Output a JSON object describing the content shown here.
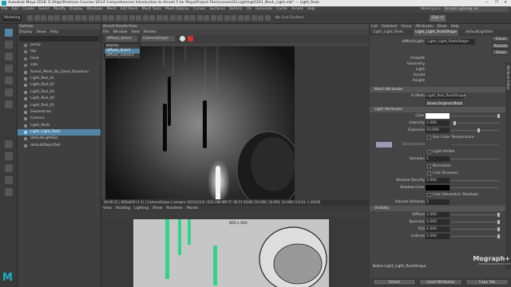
{
  "titlebar": {
    "title": "Autodesk Maya 2018: E:\\Allgs\\Premium Courses \\D\\14 Comprehensive Introduction to Arnold 5 for Maya\\Project Files\\scenes\\03 Lighting\\0303_Mesh_Light.mb* --- Light_Rods",
    "controls": "— ❐ ✕"
  },
  "menubar": {
    "items": [
      "File",
      "Edit",
      "Create",
      "Select",
      "Modify",
      "Display",
      "Windows",
      "Mesh",
      "Edit Mesh",
      "Mesh Tools",
      "Mesh Display",
      "Curves",
      "Surfaces",
      "Deform",
      "UV",
      "Generate",
      "Cache",
      "Arnold",
      "Help"
    ],
    "workspace_label": "Workspace:",
    "workspace_value": "Arnold Lighting (e)"
  },
  "shelf": {
    "mode": "Modeling",
    "live_surface": "No Live Surface",
    "signin": "Sign in"
  },
  "outliner": {
    "title": "Outliner",
    "menu": [
      "Display",
      "Show",
      "Help"
    ],
    "items": [
      {
        "label": "persp",
        "sel": false
      },
      {
        "label": "top",
        "sel": false
      },
      {
        "label": "front",
        "sel": false
      },
      {
        "label": "side",
        "sel": false
      },
      {
        "label": "Scene_Mesh_By_Dave_Davidson",
        "sel": false
      },
      {
        "label": "Light_Rod_01",
        "sel": false
      },
      {
        "label": "Light_Rod_02",
        "sel": false
      },
      {
        "label": "Light_Rod_03",
        "sel": false
      },
      {
        "label": "Light_Rod_04",
        "sel": false
      },
      {
        "label": "Light_Rod_05",
        "sel": false
      },
      {
        "label": "Geometries",
        "sel": false
      },
      {
        "label": "Camera",
        "sel": false
      },
      {
        "label": "Light_Rods",
        "sel": false
      },
      {
        "label": "Light_Light_Rods",
        "sel": true
      },
      {
        "label": "defaultLightSet",
        "sel": false
      },
      {
        "label": "defaultObjectSet",
        "sel": false
      }
    ]
  },
  "renderview": {
    "title": "Arnold RenderView",
    "menu": [
      "File",
      "Window",
      "View",
      "Render"
    ],
    "aov_value": "diffuse_direct",
    "camera_value": "CameraShape",
    "aov_options": [
      "beauty",
      "diffuse_direct",
      "diffuse_indirect"
    ],
    "status": "00:00:21 | 800x600 (1:1) | CameraShape | samples 3/2/2/2/2/0 | 833.386 MB FF: 90.21    R/266 (10.000, 10.000, 10.000)  0.8  EV: 1.40439"
  },
  "viewport": {
    "menu": [
      "View",
      "Shading",
      "Lighting",
      "Show",
      "Renderer",
      "Panels"
    ],
    "resolution": "800 x 600"
  },
  "ae": {
    "menu": [
      "List",
      "Selected",
      "Focus",
      "Attributes",
      "Show",
      "Help"
    ],
    "tabs": [
      "Light_Light_Rods",
      "Light_Light_RodsShape",
      "defaultLightSet"
    ],
    "node_label": "aiMeshLight:",
    "node_value": "Light_Light_RodsShape",
    "focus_btn": "Focus",
    "presets_btn": "Presets",
    "show_btn": "Show",
    "hide_btn": "Hide",
    "sidebar_label": "Attribute Editor",
    "derived": [
      "DrawAlt",
      "Geometry",
      "Light",
      "Arnold",
      "AiLight"
    ],
    "mesh_attrs": {
      "header": "Mesh Attributes",
      "in_mesh_label": "In Mesh",
      "in_mesh_value": "Light_Rod_RodsShape",
      "show_original": "Show Original Mesh"
    },
    "light_attrs": {
      "header": "Light Attributes",
      "color_label": "Color",
      "intensity_label": "Intensity",
      "intensity_value": "1.000",
      "intensity_pos": 0.05,
      "exposure_label": "Exposure",
      "exposure_value": "10.000",
      "exposure_pos": 0.55,
      "use_color_temp": "Use Color Temperature",
      "temperature_label": "Temperature",
      "light_visible": "Light Visible",
      "samples_label": "Samples",
      "samples_value": "1",
      "normalize": "Normalize",
      "cast_shadows": "Cast Shadows",
      "shadow_density_label": "Shadow Density",
      "shadow_density_value": "1.000",
      "shadow_color_label": "Shadow Color",
      "cast_volumetric": "Cast Volumetric Shadows",
      "volume_samples_label": "Volume Samples",
      "volume_samples_value": "2"
    },
    "visibility": {
      "header": "Visibility",
      "rows": [
        {
          "label": "Diffuse",
          "value": "1.000"
        },
        {
          "label": "Specular",
          "value": "1.000"
        },
        {
          "label": "SSS",
          "value": "1.000"
        },
        {
          "label": "Indirect",
          "value": "1.000"
        }
      ]
    },
    "notes": "Notes  Light_Light_RodsShape",
    "bottom_buttons": [
      "Select",
      "Load Attributes",
      "Copy Tab"
    ],
    "watermark_text": "Mograph+",
    "watermark_sub": "WWW.MOGRAPHPLUS.COM"
  },
  "colors": {
    "selection": "#5285a6",
    "accent": "#3aa9c8",
    "rod_glow": "#32d38a"
  }
}
